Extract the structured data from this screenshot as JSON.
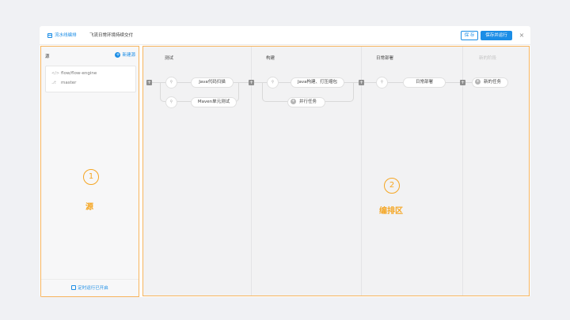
{
  "header": {
    "section_label": "流水线编排",
    "pipeline_title": "飞流日常环境持续交付",
    "save_label": "保 存",
    "save_run_label": "保存并运行",
    "close_symbol": "×"
  },
  "source_panel": {
    "title": "源",
    "new_source_label": "新建源",
    "repo": {
      "icon": "code-icon",
      "name": "flow/flow-engine",
      "branch_icon": "branch-icon",
      "branch": "master"
    },
    "badge_number": "1",
    "badge_label": "源",
    "timer_label": "定时运行已开启"
  },
  "editor": {
    "stages": [
      {
        "title": "测试",
        "tasks": [
          "Java代码扫描",
          "Maven单元测试"
        ]
      },
      {
        "title": "构建",
        "tasks": [
          "Java构建、打压缩包"
        ],
        "parallel_label": "并行任务"
      },
      {
        "title": "日常部署",
        "tasks": [
          "日常部署"
        ]
      },
      {
        "title": "新的阶段",
        "new_task_label": "新的任务"
      }
    ],
    "badge_number": "2",
    "badge_label": "编排区"
  },
  "colors": {
    "accent": "#1b8de6",
    "highlight": "#f5a623",
    "panel_border": "#f7b45d"
  }
}
